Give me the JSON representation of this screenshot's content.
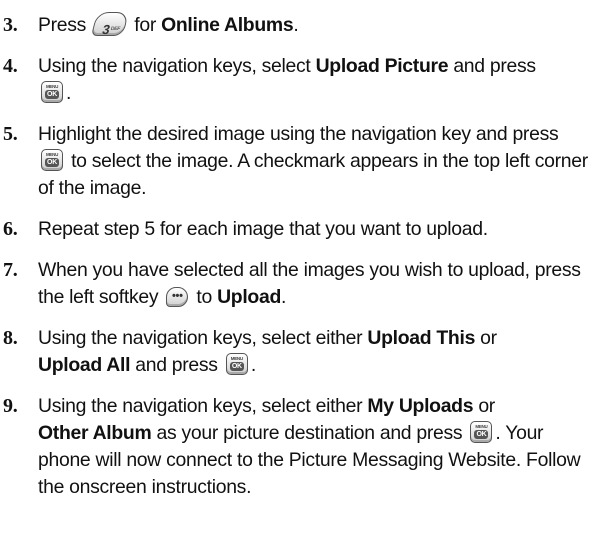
{
  "icons": {
    "menu_ok_key": {
      "name": "menu-ok-key-icon",
      "label_top": "MENU",
      "label_ok": "OK"
    },
    "key_3": {
      "name": "key-3-def-icon",
      "digit": "3",
      "letters": "DEF"
    },
    "left_softkey": {
      "name": "left-softkey-icon",
      "glyph": "•••"
    }
  },
  "steps": [
    {
      "number": "3.",
      "t1": "Press",
      "t2": "for",
      "b1": "Online Albums",
      "t3": "."
    },
    {
      "number": "4.",
      "t1": "Using the navigation keys, select",
      "b1": "Upload Picture",
      "t2": "and press",
      "t3": "."
    },
    {
      "number": "5.",
      "t1": "Highlight the desired image using the navigation key and press",
      "t2": "to select the image. A checkmark appears in the top left corner of the image."
    },
    {
      "number": "6.",
      "t1": "Repeat step 5 for each image that you want to upload."
    },
    {
      "number": "7.",
      "t1": "When you have selected all the images you wish to upload, press the left softkey",
      "t2": "to",
      "b1": "Upload",
      "t3": "."
    },
    {
      "number": "8.",
      "t1": "Using the navigation keys, select either",
      "b1": "Upload This",
      "t2": "or",
      "b2": "Upload All",
      "t3": "and press",
      "t4": "."
    },
    {
      "number": "9.",
      "t1": "Using the navigation keys, select either",
      "b1": "My Uploads",
      "t2": "or",
      "b2": "Other Album",
      "t3": "as your picture destination and press",
      "t4": ". Your phone will now connect to the Picture Messaging Website. Follow the onscreen instructions."
    }
  ]
}
